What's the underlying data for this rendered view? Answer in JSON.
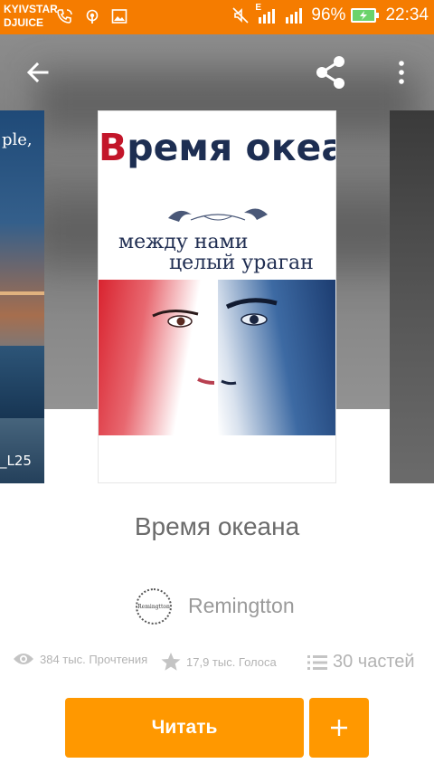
{
  "status_bar": {
    "carrier_line1": "KYIVSTAR",
    "carrier_line2": "DJUICE",
    "network_label": "E",
    "battery_percent": "96%",
    "time": "22:34",
    "icons": [
      "phone-wifi-icon",
      "hotspot-icon",
      "image-icon",
      "mute-icon",
      "signal-icon",
      "signal-icon",
      "battery-charging-icon"
    ]
  },
  "toolbar": {
    "back_icon": "arrow-back-icon",
    "share_icon": "share-icon",
    "more_icon": "more-vert-icon"
  },
  "cover": {
    "title_red": "В",
    "title_rest": "ремя океана",
    "subtitle_line1": "между нами",
    "subtitle_line2": "целый ураган"
  },
  "side_cover_left": {
    "text_top": "ple,",
    "text_bottom": "_L25"
  },
  "book": {
    "title": "Время океана",
    "author": "Remingtton",
    "author_avatar_text": "Remingtton"
  },
  "stats": {
    "reads": "384 тыс. Прочтения",
    "votes": "17,9 тыс. Голоса",
    "parts": "30 частей"
  },
  "actions": {
    "read_label": "Читать",
    "add_label": "+"
  },
  "colors": {
    "accent": "#ff9800",
    "status_bar": "#f57c00",
    "title_red": "#c3162a",
    "title_navy": "#1d2e52"
  }
}
